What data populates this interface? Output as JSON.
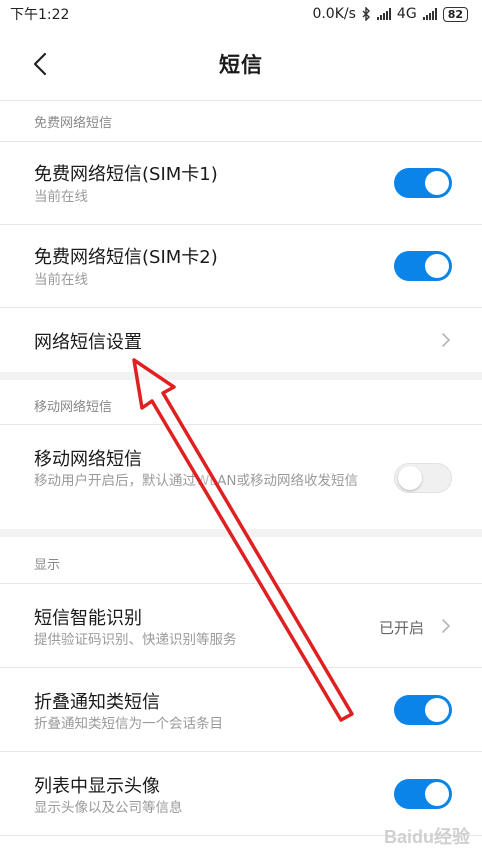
{
  "status_bar": {
    "time": "下午1:22",
    "net_speed": "0.0K/s",
    "network_type": "4G",
    "battery": "82",
    "bluetooth_icon": "bluetooth-icon"
  },
  "header": {
    "title": "短信",
    "back_icon": "chevron-left-icon"
  },
  "sections": {
    "free_network": {
      "header": "免费网络短信",
      "items": [
        {
          "title": "免费网络短信(SIM卡1)",
          "subtitle": "当前在线",
          "toggle": "on"
        },
        {
          "title": "免费网络短信(SIM卡2)",
          "subtitle": "当前在线",
          "toggle": "on"
        },
        {
          "title": "网络短信设置"
        }
      ]
    },
    "mobile_network": {
      "header": "移动网络短信",
      "items": [
        {
          "title": "移动网络短信",
          "subtitle": "移动用户开启后，默认通过WLAN或移动网络收发短信",
          "toggle": "off"
        }
      ]
    },
    "display": {
      "header": "显示",
      "items": [
        {
          "title": "短信智能识别",
          "subtitle": "提供验证码识别、快递识别等服务",
          "value": "已开启"
        },
        {
          "title": "折叠通知类短信",
          "subtitle": "折叠通知类短信为一个会话条目",
          "toggle": "on"
        },
        {
          "title": "列表中显示头像",
          "subtitle": "显示头像以及公司等信息",
          "toggle": "on"
        }
      ]
    }
  },
  "watermark": "Baidu经验",
  "colors": {
    "accent": "#0a84e8",
    "annotation_arrow": "#e02020",
    "section_gap": "#f2f2f2"
  }
}
